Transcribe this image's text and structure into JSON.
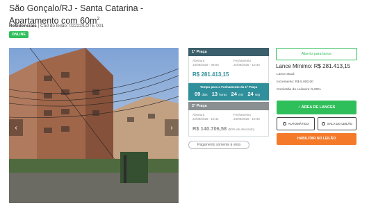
{
  "header": {
    "title": "São Gonçalo/RJ - Santa Catarina - Apartamento com 60m",
    "title_sup": "2",
    "category": "Residenciais",
    "code": " | Cód do leilão: 02222/LOTE 001",
    "status": "ONLINE"
  },
  "gallery": {
    "prev": "‹",
    "next": "›"
  },
  "praca1": {
    "title": "1ª Praça",
    "open_label": "Abertura",
    "open_value": "10/09/2026 - 09:00",
    "close_label": "Fechamento",
    "close_value": "22/09/2026 - 10:40",
    "price": "R$ 281.413,15"
  },
  "timer": {
    "title": "Tempo para o Fechamento da 1ª Praça",
    "days": "09",
    "days_label": "dias",
    "hours": "13",
    "hours_label": "horas",
    "minutes": "24",
    "minutes_label": "min",
    "seconds": "24",
    "seconds_label": "seg"
  },
  "praca2": {
    "title": "2ª Praça",
    "open_label": "Abertura",
    "open_value": "22/09/2026 - 10:41",
    "close_label": "Fechamento",
    "close_value": "23/09/2026 - 10:40",
    "price": "R$ 140.706,58",
    "discount": "(50% de desconto)"
  },
  "payment_pill": "Pagamento somente à vista",
  "side": {
    "status_button": "Aberto para lance",
    "lance_minimo": "Lance Mínimo: R$ 281.413,15",
    "lance_atual": "Lance atual:",
    "incremento": "Incremento: R$ 5.000,00",
    "comissao": "Comissão do Leiloeiro: 5,00%",
    "area_button": "ÁREA DE LANCES",
    "auto_button": "AUTOMÁTICO",
    "sala_button": "SALA DO LEILÃO",
    "habilitar_button": "HABILITAR NO LEILÃO"
  },
  "colors": {
    "green": "#2fbf5a",
    "teal": "#2f8f9b",
    "dark_teal": "#3b5f6b",
    "orange": "#f47a2a"
  }
}
